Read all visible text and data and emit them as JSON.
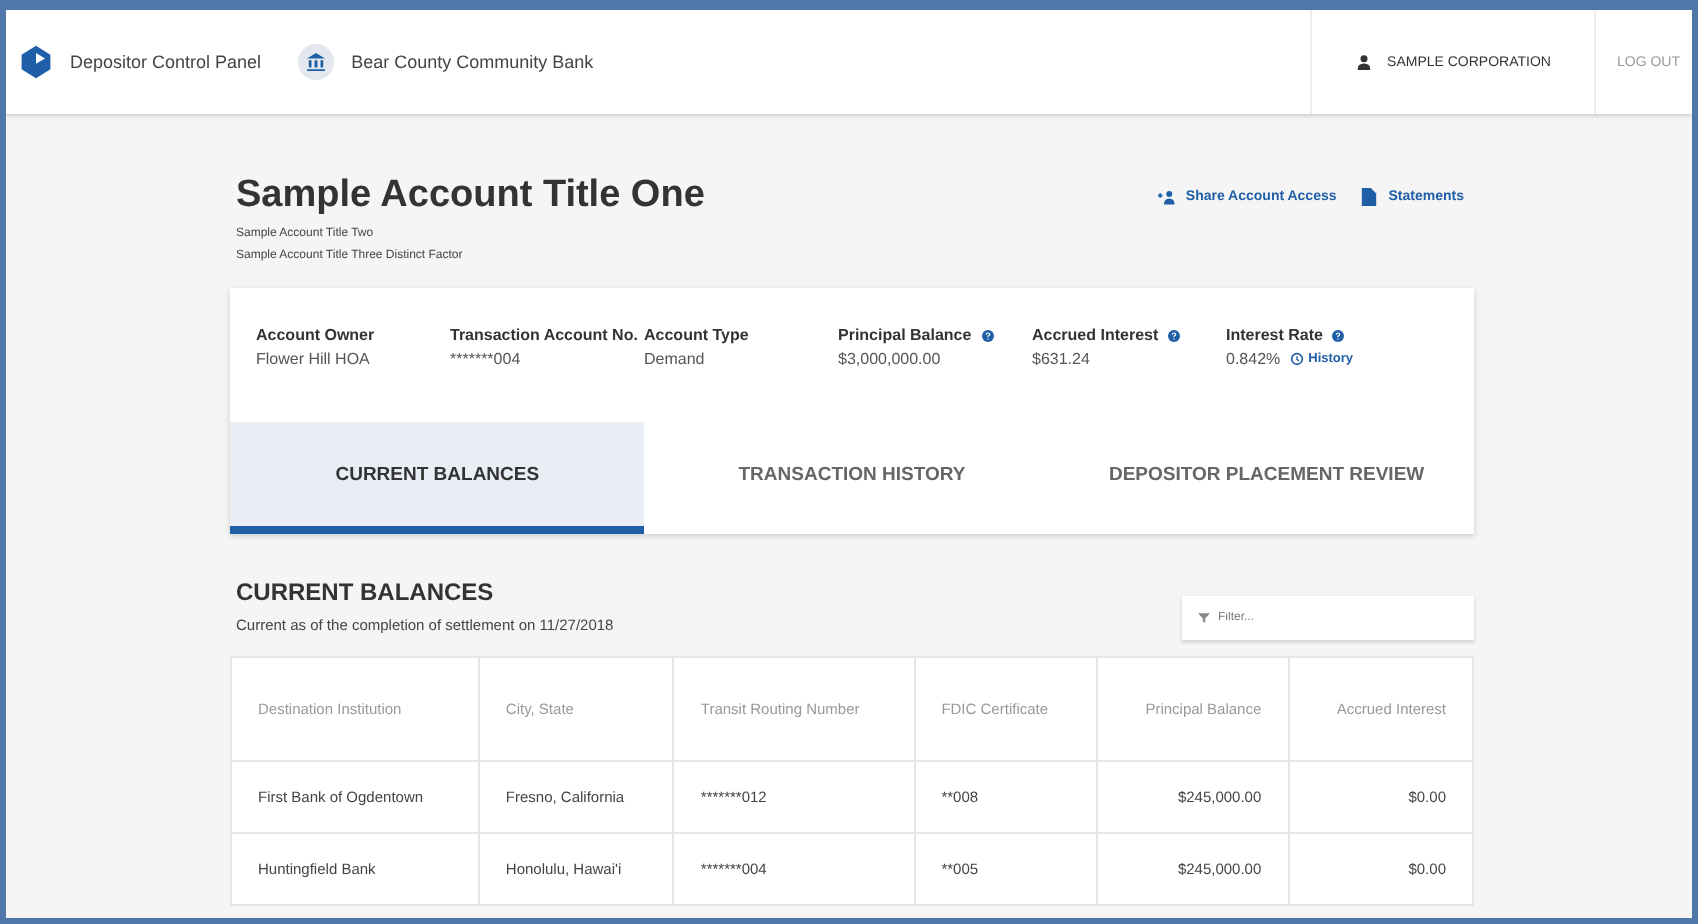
{
  "header": {
    "app_name": "Depositor Control Panel",
    "bank_name": "Bear County Community Bank",
    "user": "SAMPLE CORPORATION",
    "logout": "LOG OUT"
  },
  "account": {
    "title": "Sample Account Title One",
    "subtitles": [
      "Sample Account Title Two",
      "Sample Account Title Three Distinct Factor"
    ],
    "actions": [
      {
        "label": "Share Account Access",
        "kind": "share"
      },
      {
        "label": "Statements",
        "kind": "document"
      }
    ]
  },
  "summary": [
    {
      "label": "Account Owner",
      "value": "Flower Hill HOA",
      "help": false
    },
    {
      "label": "Transaction Account No.",
      "value": "*******004",
      "help": false
    },
    {
      "label": "Account Type",
      "value": "Demand",
      "help": false
    },
    {
      "label": "Principal Balance",
      "value": "$3,000,000.00",
      "help": true
    },
    {
      "label": "Accrued Interest",
      "value": "$631.24",
      "help": true
    },
    {
      "label": "Interest Rate",
      "value": "0.842%",
      "help": true,
      "link": "History"
    }
  ],
  "tabs": [
    {
      "label": "CURRENT BALANCES",
      "selected": true
    },
    {
      "label": "TRANSACTION HISTORY",
      "selected": false
    },
    {
      "label": "DEPOSITOR PLACEMENT REVIEW",
      "selected": false
    }
  ],
  "section": {
    "title": "CURRENT BALANCES",
    "subtitle": "Current as of the completion of settlement on 11/27/2018",
    "filter": {
      "placeholder": "Filter..."
    }
  },
  "table": {
    "columns": [
      "Destination Institution",
      "City, State",
      "Transit Routing Number",
      "FDIC Certificate",
      "Principal Balance",
      "Accrued Interest"
    ],
    "rows": [
      [
        "First Bank of Ogdentown",
        "Fresno, California",
        "*******012",
        "**008",
        "$245,000.00",
        "$0.00"
      ],
      [
        "Huntingfield Bank",
        "Honolulu, Hawai'i",
        "*******004",
        "**005",
        "$245,000.00",
        "$0.00"
      ]
    ]
  }
}
